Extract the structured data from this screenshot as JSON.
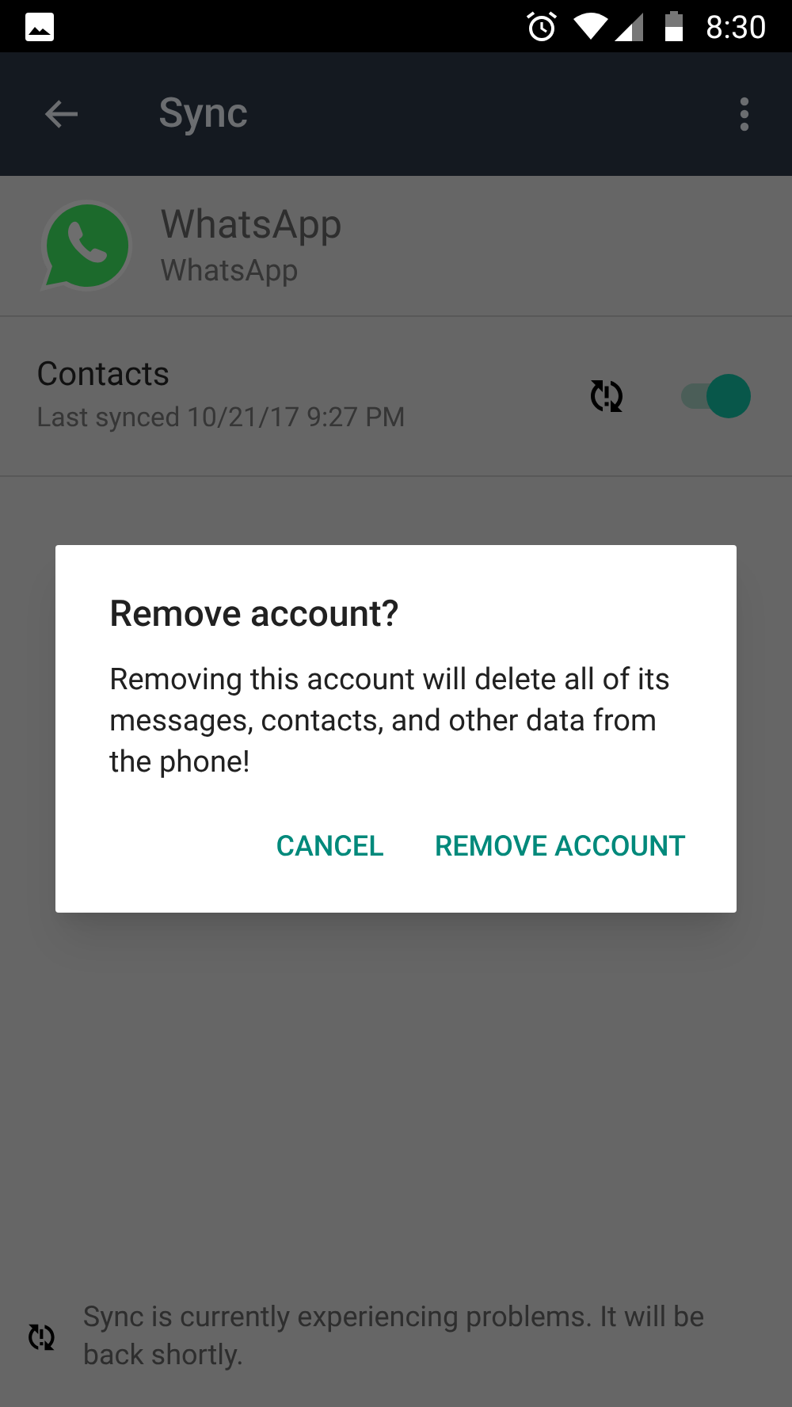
{
  "status_bar": {
    "time": "8:30"
  },
  "app_bar": {
    "title": "Sync"
  },
  "account": {
    "name": "WhatsApp",
    "type": "WhatsApp"
  },
  "sync_items": [
    {
      "label": "Contacts",
      "last_synced": "Last synced 10/21/17 9:27 PM",
      "error": true,
      "checked": true
    }
  ],
  "dialog": {
    "title": "Remove account?",
    "message": "Removing this account will delete all of its messages, contacts, and other data from the phone!",
    "buttons": [
      "CANCEL",
      "REMOVE ACCOUNT"
    ]
  },
  "footer": {
    "message": "Sync is currently experiencing problems. It will be back shortly."
  }
}
